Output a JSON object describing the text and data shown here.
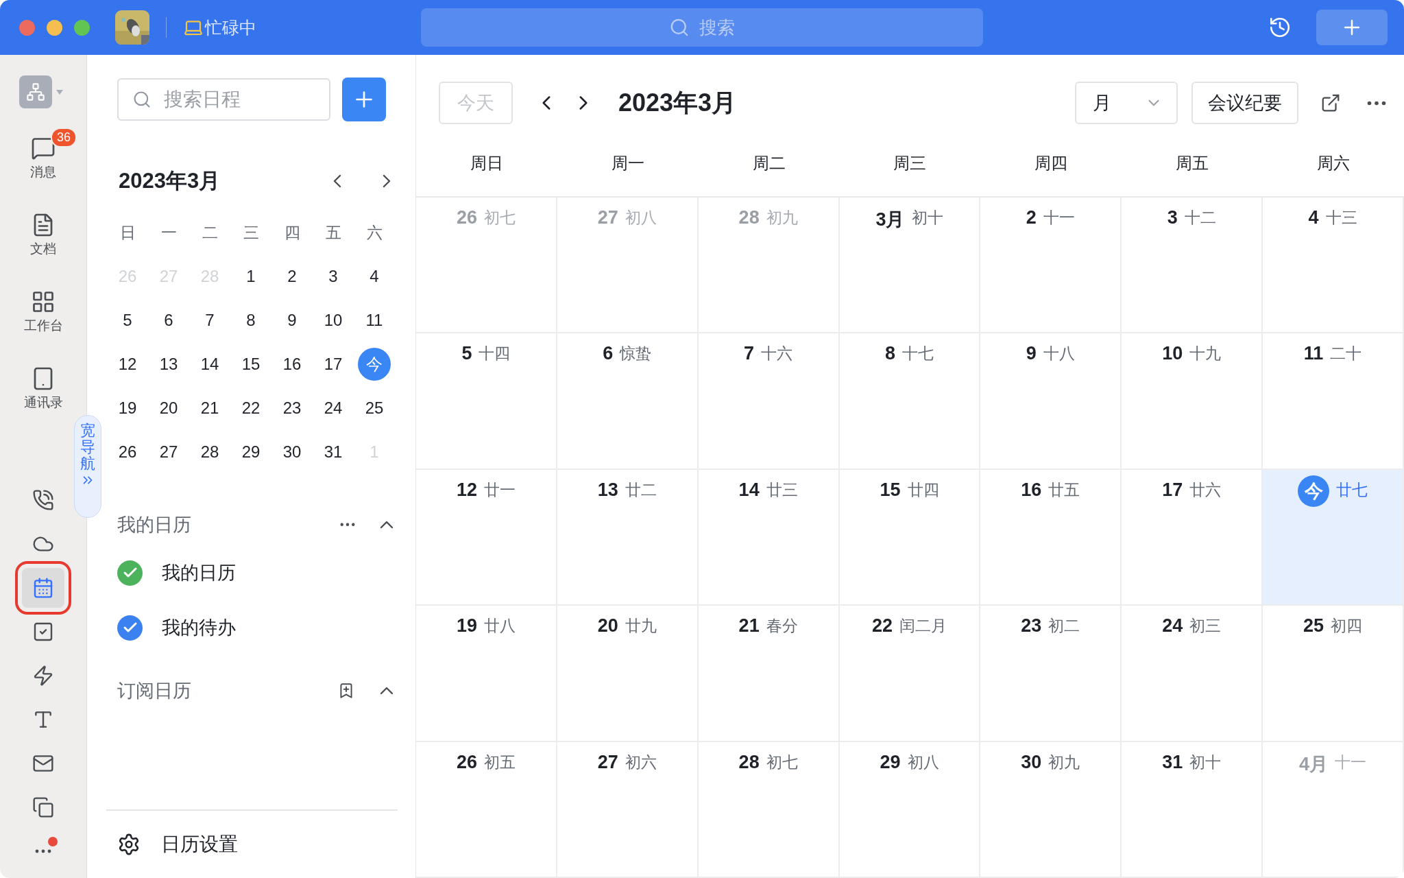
{
  "titlebar": {
    "status": "忙碌中",
    "search_placeholder": "搜索"
  },
  "rail": {
    "items": [
      {
        "label": "消息",
        "badge": "36",
        "selected": false
      },
      {
        "label": "文档",
        "selected": false
      },
      {
        "label": "工作台",
        "selected": false
      },
      {
        "label": "通讯录",
        "selected": false
      }
    ],
    "tools": [
      {
        "selected": false,
        "highlighted": false
      },
      {
        "selected": false,
        "highlighted": false
      },
      {
        "selected": true,
        "highlighted": true
      },
      {
        "selected": false,
        "highlighted": false
      },
      {
        "selected": false,
        "highlighted": false
      },
      {
        "selected": false,
        "highlighted": false
      },
      {
        "selected": false,
        "highlighted": false
      },
      {
        "selected": false,
        "highlighted": false
      },
      {
        "selected": false,
        "highlighted": false,
        "dot": true
      }
    ]
  },
  "wide_nav": {
    "label": "宽导航"
  },
  "side_panel": {
    "search_placeholder": "搜索日程",
    "mini_calendar": {
      "title": "2023年3月",
      "weekdays": [
        "日",
        "一",
        "二",
        "三",
        "四",
        "五",
        "六"
      ],
      "days": [
        {
          "label": "26",
          "in_month": false,
          "today": false
        },
        {
          "label": "27",
          "in_month": false,
          "today": false
        },
        {
          "label": "28",
          "in_month": false,
          "today": false
        },
        {
          "label": "1",
          "in_month": true,
          "today": false
        },
        {
          "label": "2",
          "in_month": true,
          "today": false
        },
        {
          "label": "3",
          "in_month": true,
          "today": false
        },
        {
          "label": "4",
          "in_month": true,
          "today": false
        },
        {
          "label": "5",
          "in_month": true,
          "today": false
        },
        {
          "label": "6",
          "in_month": true,
          "today": false
        },
        {
          "label": "7",
          "in_month": true,
          "today": false
        },
        {
          "label": "8",
          "in_month": true,
          "today": false
        },
        {
          "label": "9",
          "in_month": true,
          "today": false
        },
        {
          "label": "10",
          "in_month": true,
          "today": false
        },
        {
          "label": "11",
          "in_month": true,
          "today": false
        },
        {
          "label": "12",
          "in_month": true,
          "today": false
        },
        {
          "label": "13",
          "in_month": true,
          "today": false
        },
        {
          "label": "14",
          "in_month": true,
          "today": false
        },
        {
          "label": "15",
          "in_month": true,
          "today": false
        },
        {
          "label": "16",
          "in_month": true,
          "today": false
        },
        {
          "label": "17",
          "in_month": true,
          "today": false
        },
        {
          "label": "今",
          "in_month": true,
          "today": true
        },
        {
          "label": "19",
          "in_month": true,
          "today": false
        },
        {
          "label": "20",
          "in_month": true,
          "today": false
        },
        {
          "label": "21",
          "in_month": true,
          "today": false
        },
        {
          "label": "22",
          "in_month": true,
          "today": false
        },
        {
          "label": "23",
          "in_month": true,
          "today": false
        },
        {
          "label": "24",
          "in_month": true,
          "today": false
        },
        {
          "label": "25",
          "in_month": true,
          "today": false
        },
        {
          "label": "26",
          "in_month": true,
          "today": false
        },
        {
          "label": "27",
          "in_month": true,
          "today": false
        },
        {
          "label": "28",
          "in_month": true,
          "today": false
        },
        {
          "label": "29",
          "in_month": true,
          "today": false
        },
        {
          "label": "30",
          "in_month": true,
          "today": false
        },
        {
          "label": "31",
          "in_month": true,
          "today": false
        },
        {
          "label": "1",
          "in_month": false,
          "today": false
        }
      ]
    },
    "sections": [
      {
        "title": "我的日历",
        "expanded": true,
        "calendars": [
          {
            "name": "我的日历",
            "checked": true,
            "color": "#4cb35c"
          },
          {
            "name": "我的待办",
            "checked": true,
            "color": "#3b82f0"
          }
        ]
      },
      {
        "title": "订阅日历",
        "expanded": true
      }
    ],
    "settings": "日历设置"
  },
  "main": {
    "today_button": "今天",
    "title": "2023年3月",
    "view_select": "月",
    "minutes_button": "会议纪要",
    "weekdays": [
      "周日",
      "周一",
      "周二",
      "周三",
      "周四",
      "周五",
      "周六"
    ],
    "cells": [
      {
        "day": "26",
        "lunar": "初七",
        "in_month": false,
        "today": false
      },
      {
        "day": "27",
        "lunar": "初八",
        "in_month": false,
        "today": false
      },
      {
        "day": "28",
        "lunar": "初九",
        "in_month": false,
        "today": false
      },
      {
        "day": "3月",
        "lunar": "初十",
        "in_month": true,
        "today": false
      },
      {
        "day": "2",
        "lunar": "十一",
        "in_month": true,
        "today": false
      },
      {
        "day": "3",
        "lunar": "十二",
        "in_month": true,
        "today": false
      },
      {
        "day": "4",
        "lunar": "十三",
        "in_month": true,
        "today": false
      },
      {
        "day": "5",
        "lunar": "十四",
        "in_month": true,
        "today": false
      },
      {
        "day": "6",
        "lunar": "惊蛰",
        "in_month": true,
        "today": false
      },
      {
        "day": "7",
        "lunar": "十六",
        "in_month": true,
        "today": false
      },
      {
        "day": "8",
        "lunar": "十七",
        "in_month": true,
        "today": false
      },
      {
        "day": "9",
        "lunar": "十八",
        "in_month": true,
        "today": false
      },
      {
        "day": "10",
        "lunar": "十九",
        "in_month": true,
        "today": false
      },
      {
        "day": "11",
        "lunar": "二十",
        "in_month": true,
        "today": false
      },
      {
        "day": "12",
        "lunar": "廿一",
        "in_month": true,
        "today": false
      },
      {
        "day": "13",
        "lunar": "廿二",
        "in_month": true,
        "today": false
      },
      {
        "day": "14",
        "lunar": "廿三",
        "in_month": true,
        "today": false
      },
      {
        "day": "15",
        "lunar": "廿四",
        "in_month": true,
        "today": false
      },
      {
        "day": "16",
        "lunar": "廿五",
        "in_month": true,
        "today": false
      },
      {
        "day": "17",
        "lunar": "廿六",
        "in_month": true,
        "today": false
      },
      {
        "day": "今",
        "lunar": "廿七",
        "in_month": true,
        "today": true
      },
      {
        "day": "19",
        "lunar": "廿八",
        "in_month": true,
        "today": false
      },
      {
        "day": "20",
        "lunar": "廿九",
        "in_month": true,
        "today": false
      },
      {
        "day": "21",
        "lunar": "春分",
        "in_month": true,
        "today": false
      },
      {
        "day": "22",
        "lunar": "闰二月",
        "in_month": true,
        "today": false
      },
      {
        "day": "23",
        "lunar": "初二",
        "in_month": true,
        "today": false
      },
      {
        "day": "24",
        "lunar": "初三",
        "in_month": true,
        "today": false
      },
      {
        "day": "25",
        "lunar": "初四",
        "in_month": true,
        "today": false
      },
      {
        "day": "26",
        "lunar": "初五",
        "in_month": true,
        "today": false
      },
      {
        "day": "27",
        "lunar": "初六",
        "in_month": true,
        "today": false
      },
      {
        "day": "28",
        "lunar": "初七",
        "in_month": true,
        "today": false
      },
      {
        "day": "29",
        "lunar": "初八",
        "in_month": true,
        "today": false
      },
      {
        "day": "30",
        "lunar": "初九",
        "in_month": true,
        "today": false
      },
      {
        "day": "31",
        "lunar": "初十",
        "in_month": true,
        "today": false
      },
      {
        "day": "4月",
        "lunar": "十一",
        "in_month": false,
        "today": false
      }
    ]
  }
}
